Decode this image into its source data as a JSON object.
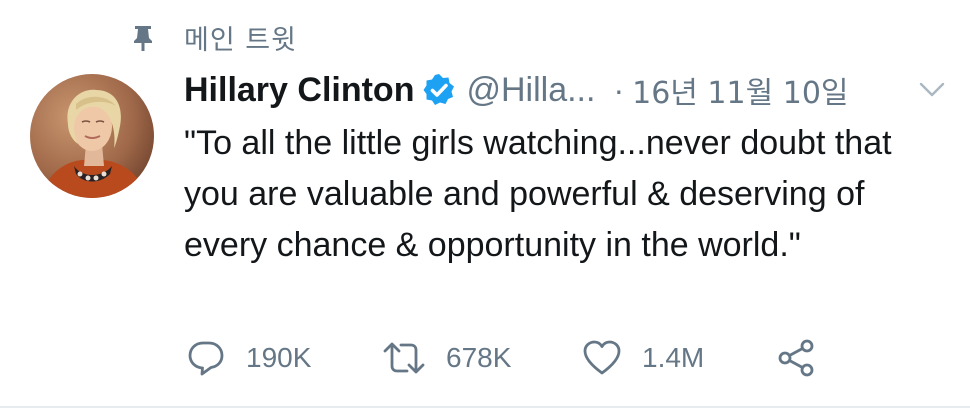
{
  "pinned": {
    "label": "메인 트윗",
    "icon": "pin-icon"
  },
  "author": {
    "display_name": "Hillary Clinton",
    "verified": true,
    "verified_icon": "verified-badge-icon",
    "handle": "@Hilla...",
    "avatar_icon": "avatar-photo"
  },
  "meta": {
    "separator": "·",
    "timestamp": "16년 11월 10일",
    "menu_icon": "chevron-down-icon"
  },
  "tweet": {
    "text": "\"To all the little girls watching...never doubt that you are valuable and powerful & deserving of every chance & opportunity in the world.\""
  },
  "actions": {
    "reply": {
      "icon": "reply-icon",
      "count": "190K"
    },
    "retweet": {
      "icon": "retweet-icon",
      "count": "678K"
    },
    "like": {
      "icon": "heart-icon",
      "count": "1.4M"
    },
    "share": {
      "icon": "share-icon"
    }
  },
  "colors": {
    "text_primary": "#14171a",
    "text_secondary": "#657786",
    "verified_blue": "#1da1f2",
    "divider": "#e6ecf0"
  }
}
